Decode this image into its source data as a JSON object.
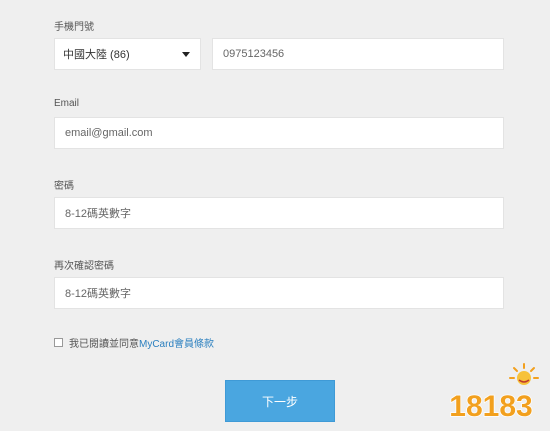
{
  "form": {
    "phone_label": "手機門號",
    "country_select": "中國大陸 (86)",
    "phone_value": "0975123456",
    "email_label": "Email",
    "email_placeholder": "email@gmail.com",
    "password_label": "密碼",
    "password_placeholder": "8-12碼英數字",
    "confirm_label": "再次確認密碼",
    "confirm_placeholder": "8-12碼英數字",
    "agree_prefix": "我已閱讀並同意",
    "terms_link": "MyCard會員條款",
    "next_button": "下一步"
  },
  "watermark": {
    "text": "18183"
  },
  "colors": {
    "accent": "#4aa6e0",
    "link": "#2a7fbf",
    "logo": "#f2a01e"
  }
}
